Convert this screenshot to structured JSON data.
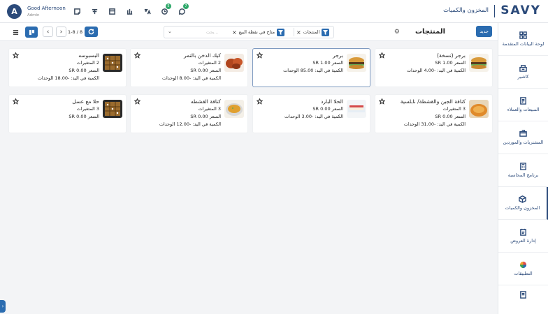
{
  "header": {
    "avatar_letter": "A",
    "greeting": "Good Afternoon",
    "user_role": "Admin",
    "breadcrumb": "المخزون والكميات",
    "logo": "SAVY",
    "badges": {
      "activity": "5",
      "chat": "7"
    }
  },
  "sidebar": {
    "items": [
      {
        "label": "لوحة البيانات المتقدمة",
        "icon": "dashboard-icon"
      },
      {
        "label": "كاشير",
        "icon": "cashier-icon"
      },
      {
        "label": "المبيعات والعملاء",
        "icon": "sales-icon"
      },
      {
        "label": "المشتريات والموردين",
        "icon": "purchases-icon"
      },
      {
        "label": "برنامج المحاسبة",
        "icon": "accounting-icon"
      },
      {
        "label": "المخزون والكميات",
        "icon": "inventory-icon"
      },
      {
        "label": "إدارة العروض",
        "icon": "offers-icon"
      },
      {
        "label": "التطبيقات",
        "icon": "apps-icon"
      }
    ]
  },
  "toolbar": {
    "new_label": "جديد",
    "page_title": "المنتجات",
    "filters": [
      {
        "label": "المنتجات"
      },
      {
        "label": "متاح في نقطة البيع"
      }
    ],
    "search_placeholder": "بحث...",
    "pager": "1-8 / 8"
  },
  "products": [
    {
      "name": "برجر (نسخة)",
      "lines": [
        "السعر 1.00 SR",
        "الكمية في اليد: -4.00 الوحدات"
      ],
      "img": "burger"
    },
    {
      "name": "برجر",
      "lines": [
        "السعر 1.00 SR",
        "الكمية في اليد: 85.00 الوحدات"
      ],
      "img": "burger"
    },
    {
      "name": "كيك الدخن بالتمر",
      "lines": [
        "2 المتغيرات",
        "السعر 0.00 SR",
        "الكمية في اليد: -8.00 الوحدات"
      ],
      "img": "cake"
    },
    {
      "name": "البسبوسه",
      "lines": [
        "2 المتغيرات",
        "السعر 0.00 SR",
        "الكمية في اليد: -18.00 الوحدات"
      ],
      "img": "basbousa"
    },
    {
      "name": "كنافة الجبن والقشطة/ نابلسية",
      "lines": [
        "3 المتغيرات",
        "السعر 0.00 SR",
        "الكمية في اليد: -31.00 الوحدات"
      ],
      "img": "kunafa"
    },
    {
      "name": "الحلا البارد",
      "lines": [
        "السعر 0.00 SR",
        "الكمية في اليد: -3.00 الوحدات"
      ],
      "img": "cold"
    },
    {
      "name": "كنافة القشطه",
      "lines": [
        "3 المتغيرات",
        "السعر 0.00 SR",
        "الكمية في اليد: -12.00 الوحدات"
      ],
      "img": "soup"
    },
    {
      "name": "حلا مع عسل",
      "lines": [
        "3 المتغيرات",
        "السعر 0.00 SR"
      ],
      "img": "basbousa"
    }
  ]
}
